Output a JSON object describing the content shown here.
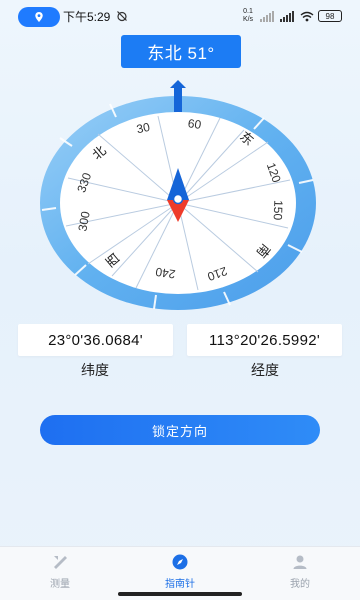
{
  "status_bar": {
    "time": "下午5:29",
    "network_speed": "0.1 K/s",
    "battery": "98"
  },
  "heading": "东北 51°",
  "compass": {
    "numeric_labels": [
      "30",
      "60",
      "120",
      "150",
      "210",
      "240",
      "300",
      "330"
    ],
    "cardinal_labels": {
      "north": "北",
      "east": "东",
      "south": "南",
      "west": "西"
    },
    "ring_color": "#4aa6ee",
    "needle_north_color": "#1565d8",
    "needle_south_color": "#ee3b2a"
  },
  "coordinates": {
    "latitude_value": "23°0'36.0684'",
    "latitude_label": "纬度",
    "longitude_value": "113°20'26.5992'",
    "longitude_label": "经度"
  },
  "lock_button": "锁定方向",
  "bottom_nav": {
    "items": [
      {
        "label": "测量",
        "icon": "ruler-icon",
        "active": false
      },
      {
        "label": "指南针",
        "icon": "compass-icon",
        "active": true
      },
      {
        "label": "我的",
        "icon": "user-icon",
        "active": false
      }
    ],
    "active_color": "#1c6fe6",
    "inactive_color": "#9aa2ad"
  }
}
